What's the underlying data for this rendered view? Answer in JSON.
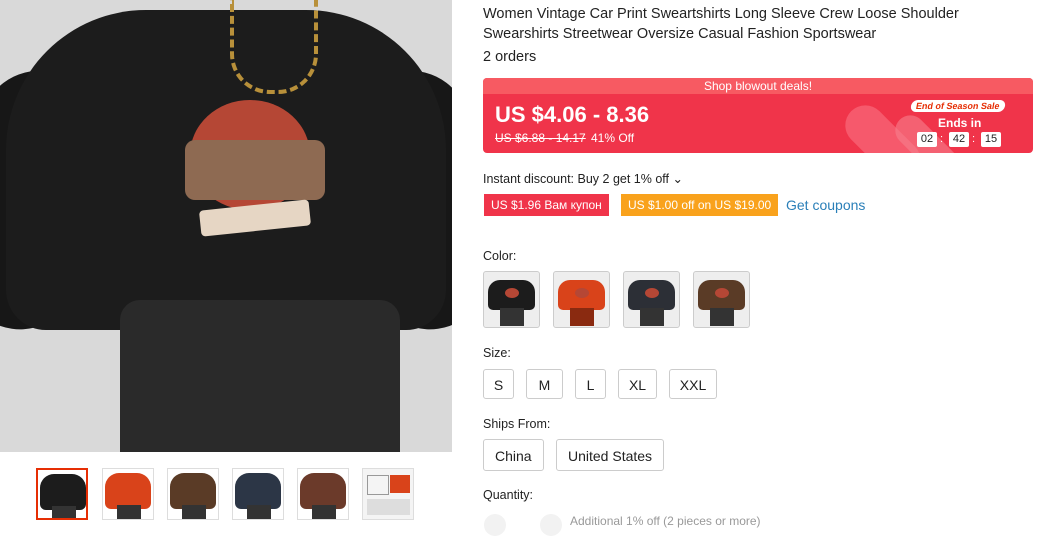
{
  "product": {
    "title": "Women Vintage Car Print Sweartshirts Long Sleeve Crew Loose Shoulder Swearshirts Streetwear Oversize Casual Fashion Sportswear",
    "orders": "2 orders"
  },
  "deal": {
    "header": "Shop blowout deals!",
    "price": "US $4.06 - 8.36",
    "original_price": "US $6.88 - 14.17",
    "discount": "41% Off",
    "badge": "End of Season Sale",
    "ends_in": "Ends in",
    "timer": {
      "hours": "02",
      "minutes": "42",
      "seconds": "15"
    },
    "colors": {
      "background": "#f0344a",
      "header": "#f75a62"
    }
  },
  "instant_discount": "Instant discount: Buy 2 get 1% off ⌄",
  "coupons": {
    "coupon1": "US $1.96 Вам купон",
    "coupon2": "US $1.00 off on US $19.00",
    "get_coupons": "Get coupons"
  },
  "color_label": "Color:",
  "color_options": [
    {
      "name": "black",
      "color": "#1c1c1c"
    },
    {
      "name": "orange",
      "color": "#d9431a"
    },
    {
      "name": "dark-gray",
      "color": "#2c2f36"
    },
    {
      "name": "brown",
      "color": "#5a3b26"
    }
  ],
  "size_label": "Size:",
  "sizes": [
    "S",
    "M",
    "L",
    "XL",
    "XXL"
  ],
  "ships_from_label": "Ships From:",
  "ships_from": [
    "China",
    "United States"
  ],
  "quantity_label": "Quantity:",
  "quantity_note": "Additional 1% off (2 pieces or more)",
  "thumbnails": [
    {
      "name": "black",
      "color": "#1c1c1c"
    },
    {
      "name": "orange",
      "color": "#d9431a"
    },
    {
      "name": "brown",
      "color": "#5a3b26"
    },
    {
      "name": "navy",
      "color": "#2c3646"
    },
    {
      "name": "multi",
      "color": "#6b3a2a"
    },
    {
      "name": "size-chart",
      "color": "#f4f4f4"
    }
  ]
}
